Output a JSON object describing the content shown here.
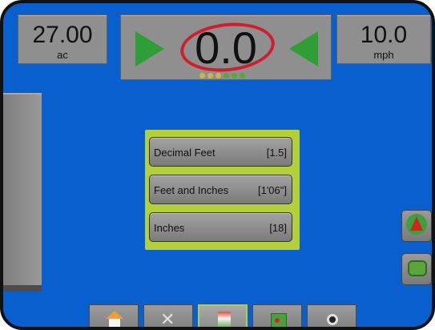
{
  "header": {
    "area_value": "27.00",
    "area_unit": "ac",
    "crosstrack_value": "0.0",
    "speed_value": "10.0",
    "speed_unit": "mph"
  },
  "units_menu": {
    "items": [
      {
        "label": "Decimal Feet",
        "value": "[1.5]"
      },
      {
        "label": "Feet and Inches",
        "value": "[1'06\"]"
      },
      {
        "label": "Inches",
        "value": "[18]"
      }
    ]
  },
  "toolbar": {
    "buttons": [
      {
        "icon": "home-icon"
      },
      {
        "icon": "tools-icon"
      },
      {
        "icon": "guidance-icon",
        "active": true
      },
      {
        "icon": "map-icon"
      },
      {
        "icon": "camera-icon"
      }
    ]
  },
  "side_buttons": [
    {
      "icon": "navigation-icon"
    },
    {
      "icon": "guidance-view-icon"
    }
  ],
  "colors": {
    "background": "#0a5fcf",
    "menu_highlight": "#b3cf3a",
    "steer_arrow": "#2f9e36",
    "annotation_red": "#d01e2e"
  }
}
